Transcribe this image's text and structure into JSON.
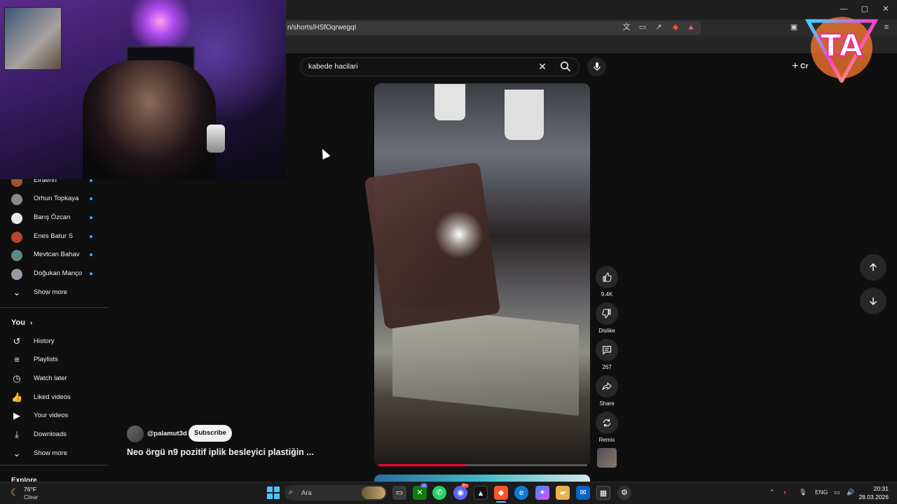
{
  "browser": {
    "url": "n/shorts/HSfOqrwegqI",
    "window_controls": [
      "—",
      "▢",
      "✕"
    ]
  },
  "sidebar": {
    "subscriptions": [
      {
        "name": "Elraenn"
      },
      {
        "name": "Orhun Topkaya"
      },
      {
        "name": "Barış Özcan"
      },
      {
        "name": "Enes Batur S"
      },
      {
        "name": "Mevtcan Bahav"
      },
      {
        "name": "Doğukan Manço"
      }
    ],
    "subs_show_more": "Show more",
    "you_heading": "You",
    "you_items": [
      {
        "label": "History",
        "icon": "history-icon"
      },
      {
        "label": "Playlists",
        "icon": "playlists-icon"
      },
      {
        "label": "Watch later",
        "icon": "watch-later-icon"
      },
      {
        "label": "Liked videos",
        "icon": "liked-videos-icon"
      },
      {
        "label": "Your videos",
        "icon": "your-videos-icon"
      },
      {
        "label": "Downloads",
        "icon": "downloads-icon"
      }
    ],
    "you_show_more": "Show more",
    "explore_heading": "Explore"
  },
  "search": {
    "query": "kabede hacilari"
  },
  "header": {
    "create_label": "Cr"
  },
  "short": {
    "channel_handle": "@palamut3d",
    "subscribe_label": "Subscribe",
    "title": "Neo örgü n9 pozitif iplik besleyici plastiğin ...",
    "progress_fraction": 0.42,
    "actions": {
      "like_count": "9.4K",
      "dislike_label": "Dislike",
      "comment_count": "267",
      "share_label": "Share",
      "remix_label": "Remix"
    }
  },
  "taskbar": {
    "weather_temp": "76°F",
    "weather_cond": "Clear",
    "search_placeholder": "Ara",
    "lang": "ENG",
    "time": "20:31",
    "date": "28.03.2026",
    "badge_discord": "9+",
    "badge_xbox": "11"
  },
  "colors": {
    "accent_red": "#ff0033",
    "link_blue": "#3ea6ff",
    "bg": "#0f0f0f"
  }
}
